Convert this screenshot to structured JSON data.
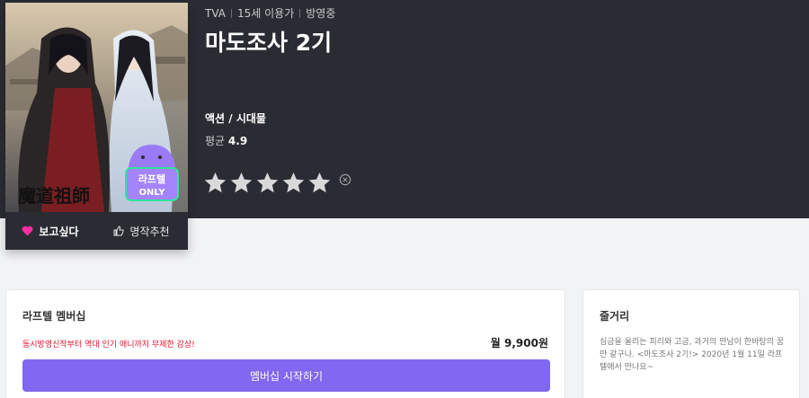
{
  "poster": {
    "calligraphy": "魔道祖師",
    "badge_line1": "라프텔",
    "badge_line2": "ONLY"
  },
  "actions": {
    "want_label": "보고싶다",
    "recommend_label": "명작추천"
  },
  "meta": {
    "type": "TVA",
    "age": "15세 이용가",
    "status": "방영중"
  },
  "title": "마도조사 2기",
  "genre": "액션 / 시대물",
  "rating": {
    "label": "평균",
    "value": "4.9",
    "stars_filled": 0,
    "stars_total": 5
  },
  "membership": {
    "title": "라프텔 멤버십",
    "promo": "동시방영신작부터 역대 인기 애니까지 무제한 감상!",
    "price": "월 9,900원",
    "button_label": "멤버십 시작하기"
  },
  "synopsis": {
    "title": "줄거리",
    "text": "심금을 울리는 피리와 고금, 과거의 만남이 한바탕의 꿈만 같구나. <마도조사 2기!> 2020년 1월 11일 라프텔에서 만나요~"
  },
  "colors": {
    "hero_bg": "#2b2c33",
    "accent": "#8068f0",
    "promo": "#e2142d",
    "heart": "#ff2ea0",
    "star": "#d9d9d9"
  }
}
